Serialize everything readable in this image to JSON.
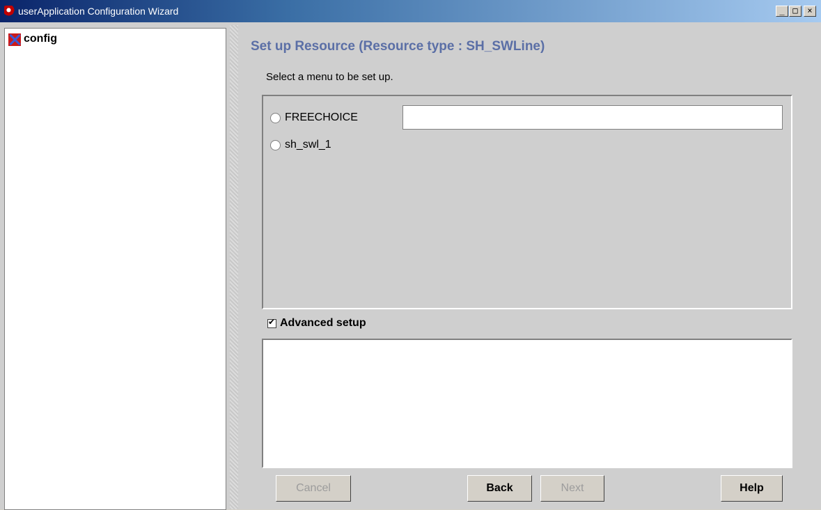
{
  "window": {
    "title": "userApplication Configuration Wizard",
    "controls": {
      "minimize": "_",
      "maximize": "□",
      "close": "×"
    }
  },
  "tree": {
    "root_label": "config"
  },
  "main": {
    "title": "Set up Resource (Resource type : SH_SWLine)",
    "instruction": "Select a menu to be set up.",
    "options": [
      {
        "label": "FREECHOICE",
        "selected": false
      },
      {
        "label": "sh_swl_1",
        "selected": false
      }
    ],
    "freechoice_value": "",
    "advanced_setup": {
      "label": "Advanced setup",
      "checked": true
    }
  },
  "buttons": {
    "cancel": "Cancel",
    "back": "Back",
    "next": "Next",
    "help": "Help"
  },
  "colors": {
    "title_accent": "#5b6fa6",
    "titlebar_start": "#0a246a",
    "titlebar_end": "#a6caf0"
  }
}
